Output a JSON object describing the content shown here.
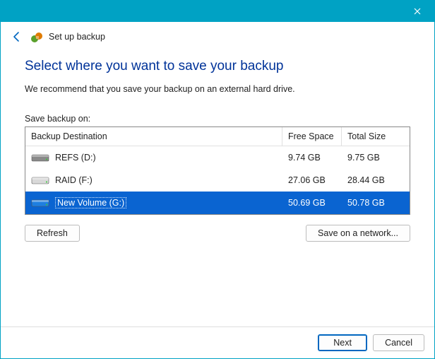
{
  "window": {
    "title": "Set up backup"
  },
  "page": {
    "heading": "Select where you want to save your backup",
    "recommend": "We recommend that you save your backup on an external hard drive.",
    "save_label": "Save backup on:"
  },
  "table": {
    "headers": {
      "destination": "Backup Destination",
      "free": "Free Space",
      "total": "Total Size"
    },
    "rows": [
      {
        "name": "REFS (D:)",
        "free": "9.74 GB",
        "total": "9.75 GB",
        "selected": false,
        "color": "#8a8a8a"
      },
      {
        "name": "RAID (F:)",
        "free": "27.06 GB",
        "total": "28.44 GB",
        "selected": false,
        "color": "#d9d9d9"
      },
      {
        "name": "New Volume (G:)",
        "free": "50.69 GB",
        "total": "50.78 GB",
        "selected": true,
        "color": "#1e7fe0"
      }
    ]
  },
  "buttons": {
    "refresh": "Refresh",
    "save_network": "Save on a network...",
    "next": "Next",
    "cancel": "Cancel"
  }
}
